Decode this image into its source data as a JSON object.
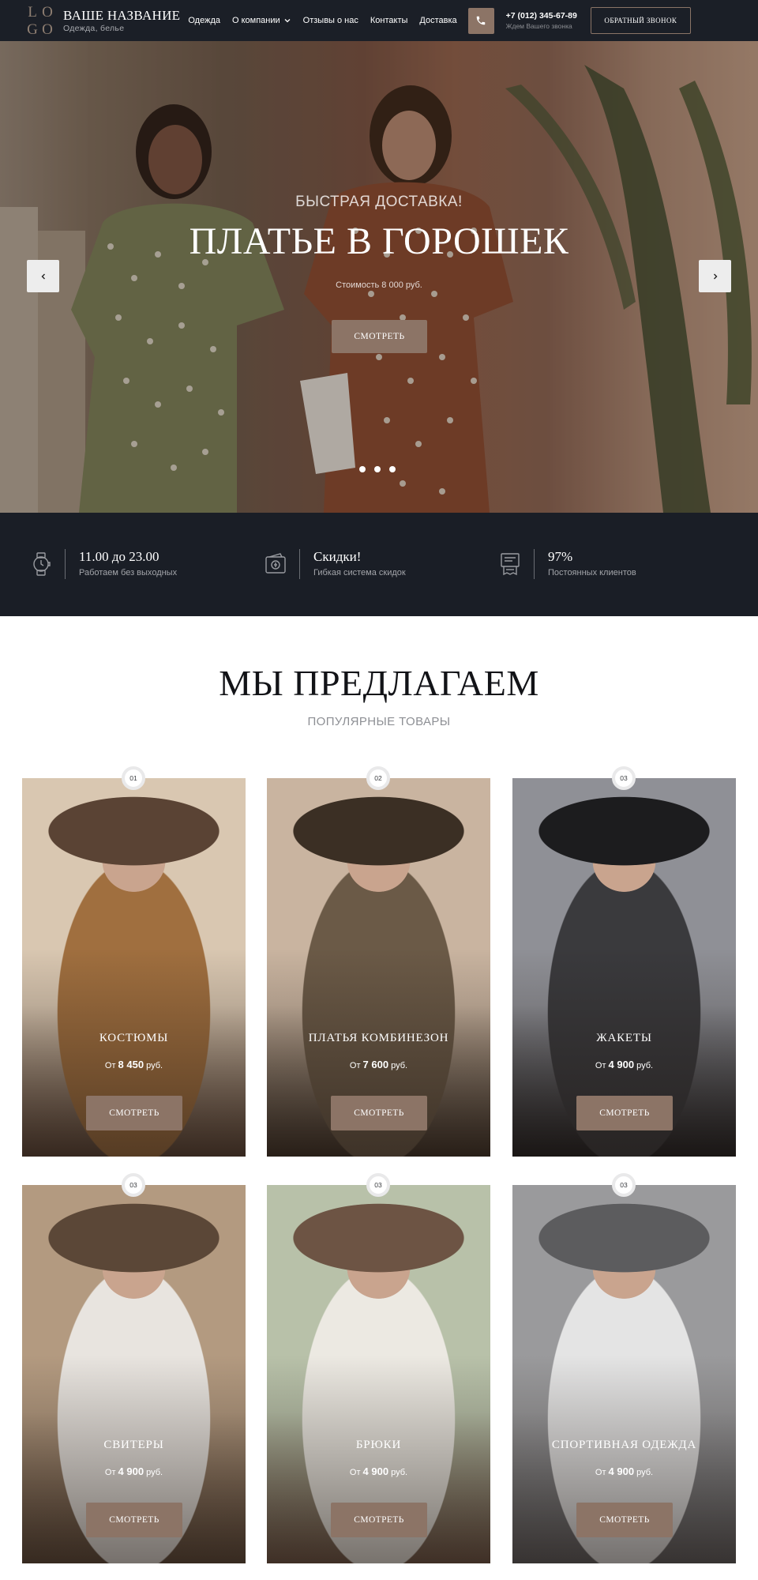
{
  "header": {
    "logo": [
      "L",
      "O",
      "G",
      "O"
    ],
    "brand_name": "ВАШЕ НАЗВАНИЕ",
    "brand_sub": "Одежда, белье",
    "nav": [
      "Одежда",
      "О компании",
      "Отзывы о нас",
      "Контакты",
      "Доставка"
    ],
    "phone": "+7 (012) 345-67-89",
    "phone_note": "Ждем Вашего звонка",
    "callback_label": "ОБРАТНЫЙ ЗВОНОК",
    "icons": {
      "phone": "phone-icon",
      "dropdown": "chevron-down-icon"
    }
  },
  "hero": {
    "kicker": "БЫСТРАЯ ДОСТАВКА!",
    "title": "ПЛАТЬЕ В ГОРОШЕК",
    "price_text": "Стоимость 8 000 руб.",
    "button": "СМОТРЕТЬ",
    "slides": 3
  },
  "features": [
    {
      "icon": "watch-icon",
      "title": "11.00 до 23.00",
      "sub": "Работаем без выходных"
    },
    {
      "icon": "wallet-icon",
      "title": "Скидки!",
      "sub": "Гибкая система скидок"
    },
    {
      "icon": "receipt-icon",
      "title": "97%",
      "sub": "Постоянных клиентов"
    }
  ],
  "offer": {
    "title": "МЫ ПРЕДЛАГАЕМ",
    "subtitle": "ПОПУЛЯРНЫЕ ТОВАРЫ",
    "price_prefix": "От",
    "currency": "руб.",
    "button": "СМОТРЕТЬ",
    "cards": [
      {
        "badge": "01",
        "name": "КОСТЮМЫ",
        "price": "8 450",
        "colors": [
          "#d9c7b1",
          "#a06f3f",
          "#5a4334"
        ]
      },
      {
        "badge": "02",
        "name": "ПЛАТЬЯ КОМБИНЕЗОН",
        "price": "7 600",
        "colors": [
          "#c9b4a0",
          "#6b5a47",
          "#3b2f24"
        ]
      },
      {
        "badge": "03",
        "name": "ЖАКЕТЫ",
        "price": "4 900",
        "colors": [
          "#8f9096",
          "#3a3a3d",
          "#1c1c1e"
        ]
      },
      {
        "badge": "03",
        "name": "СВИТЕРЫ",
        "price": "4 900",
        "colors": [
          "#b39a80",
          "#e8e4df",
          "#5b4737"
        ]
      },
      {
        "badge": "03",
        "name": "БРЮКИ",
        "price": "4 900",
        "colors": [
          "#b8c1a9",
          "#ece9e2",
          "#6d5444"
        ]
      },
      {
        "badge": "03",
        "name": "СПОРТИВНАЯ ОДЕЖДА",
        "price": "4 900",
        "colors": [
          "#9a9a9c",
          "#e4e4e4",
          "#5c5c5e"
        ]
      }
    ]
  }
}
